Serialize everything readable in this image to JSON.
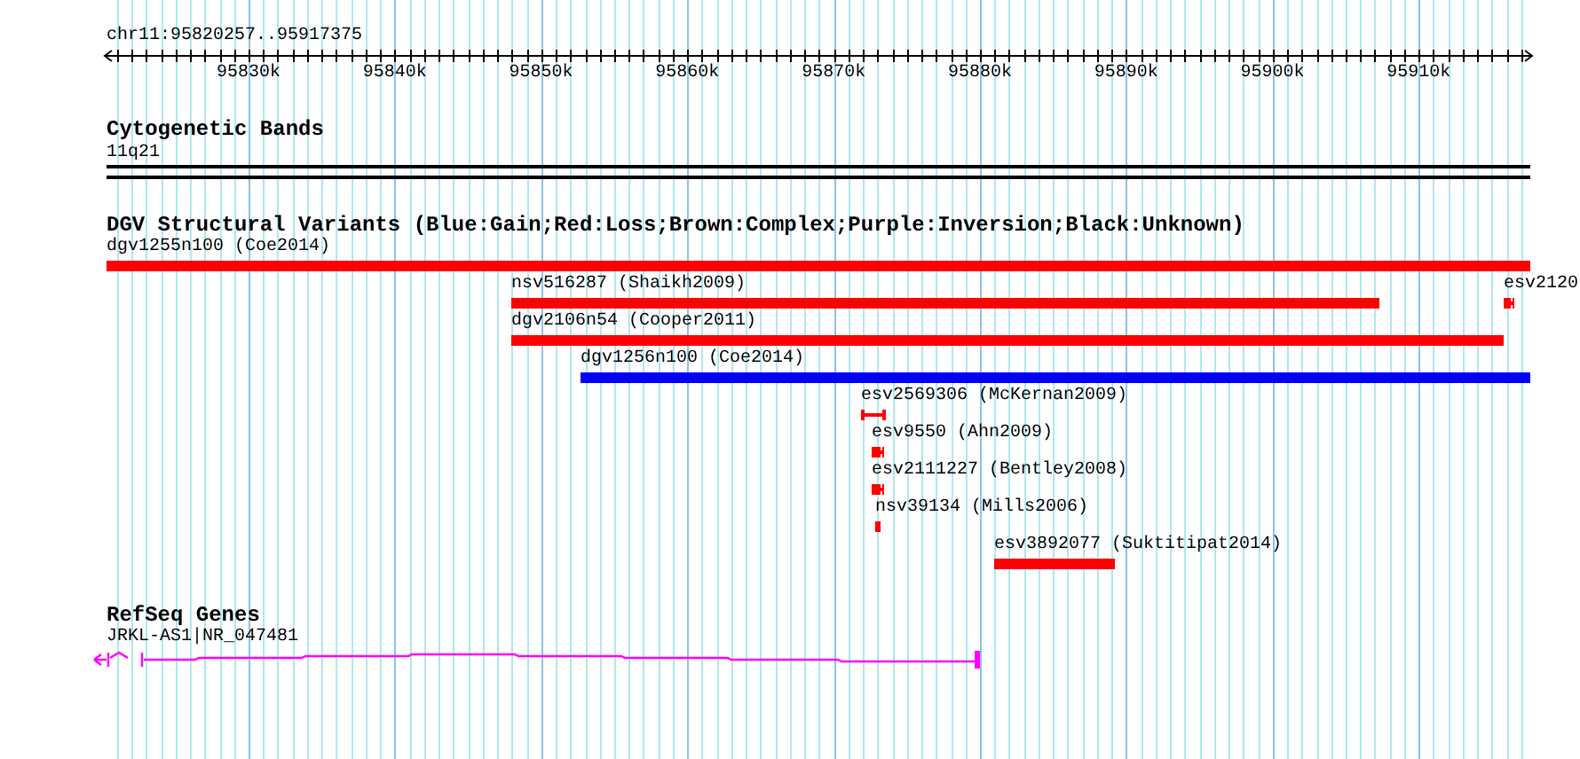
{
  "ruler": {
    "range": "chr11:95820257..95917375",
    "ticks": [
      "95830k",
      "95840k",
      "95850k",
      "95860k",
      "95870k",
      "95880k",
      "95890k",
      "95900k",
      "95910k"
    ]
  },
  "tracks": [
    {
      "kind": "bands",
      "title": "Cytogenetic Bands",
      "features": [
        {
          "label": "11q21"
        }
      ]
    },
    {
      "kind": "variants",
      "title": "DGV Structural Variants (Blue:Gain;Red:Loss;Brown:Complex;Purple:Inversion;Black:Unknown)",
      "features": [
        {
          "label": "dgv1255n100 (Coe2014)",
          "color": "#ff0000"
        },
        {
          "label": "nsv516287 (Shaikh2009)",
          "color": "#ff0000"
        },
        {
          "label": "esv2120",
          "color": "#ff0000"
        },
        {
          "label": "dgv2106n54 (Cooper2011)",
          "color": "#ff0000"
        },
        {
          "label": "dgv1256n100 (Coe2014)",
          "color": "#0000ff"
        },
        {
          "label": "esv2569306 (McKernan2009)",
          "color": "#ff0000"
        },
        {
          "label": "esv9550 (Ahn2009)",
          "color": "#ff0000"
        },
        {
          "label": "esv2111227 (Bentley2008)",
          "color": "#ff0000"
        },
        {
          "label": "nsv39134 (Mills2006)",
          "color": "#ff0000"
        },
        {
          "label": "esv3892077 (Suktitipat2014)",
          "color": "#ff0000"
        }
      ]
    },
    {
      "kind": "genes",
      "title": "RefSeq Genes",
      "features": [
        {
          "label": "JRKL-AS1|NR_047481",
          "color": "#ff00ff"
        }
      ]
    }
  ]
}
